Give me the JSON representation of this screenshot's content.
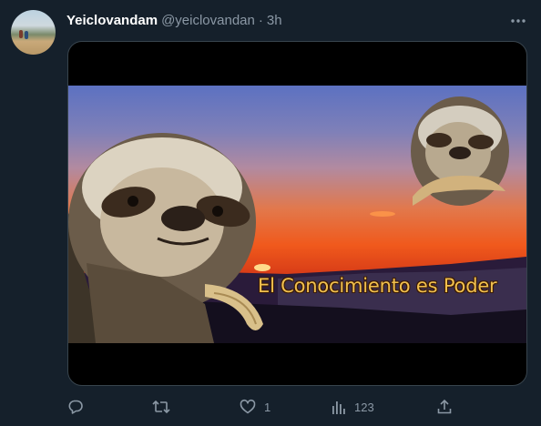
{
  "tweet": {
    "display_name": "Yeiclovandam",
    "handle": "@yeiclovandan",
    "separator": "·",
    "time": "3h",
    "media_caption": "El Conocimiento es Poder"
  },
  "actions": {
    "reply_count": "",
    "retweet_count": "",
    "like_count": "1",
    "views_count": "123"
  },
  "icons": {
    "more": "more-horizontal-icon",
    "reply": "speech-bubble-icon",
    "retweet": "retweet-arrows-icon",
    "like": "heart-outline-icon",
    "views": "bar-chart-icon",
    "share": "share-upload-icon"
  },
  "colors": {
    "background": "#15202b",
    "primary_text": "#ffffff",
    "secondary_text": "#8b98a5",
    "border": "#38444d",
    "caption_text": "#f1c04e"
  }
}
